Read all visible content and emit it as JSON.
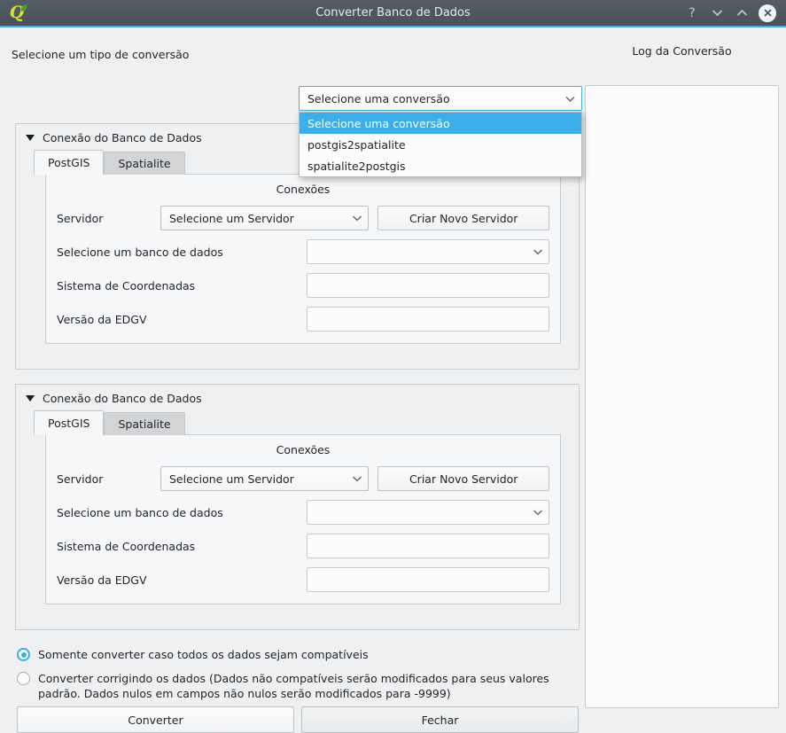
{
  "window": {
    "title": "Converter Banco de Dados",
    "app_icon": "qgis-logo-icon",
    "controls": {
      "help": "?",
      "minimize": "minimize-icon",
      "maximize": "maximize-icon",
      "close": "close-icon"
    },
    "accent_color": "#3daee9",
    "titlebar_color": "#4d555c",
    "background_color": "#eff0f1"
  },
  "conversion": {
    "label": "Selecione um tipo de conversão",
    "combo_value": "Selecione uma conversão",
    "dropdown_open": true,
    "options": [
      "Selecione uma conversão",
      "postgis2spatialite",
      "spatialite2postgis"
    ],
    "selected_index": 0
  },
  "group_source": {
    "title": "Conexão do Banco de Dados",
    "expanded": true,
    "tabs": [
      {
        "label": "PostGIS",
        "active": true
      },
      {
        "label": "Spatialite",
        "active": false
      }
    ],
    "panel_title": "Conexões",
    "fields": {
      "servidor_label": "Servidor",
      "servidor_value": "Selecione um Servidor",
      "criar_servidor_button": "Criar Novo Servidor",
      "banco_label": "Selecione um banco de dados",
      "banco_value": "",
      "sistema_label": "Sistema de Coordenadas",
      "sistema_value": "",
      "edgv_label": "Versão da EDGV",
      "edgv_value": ""
    }
  },
  "group_target": {
    "title": "Conexão do Banco de Dados",
    "expanded": true,
    "tabs": [
      {
        "label": "PostGIS",
        "active": true
      },
      {
        "label": "Spatialite",
        "active": false
      }
    ],
    "panel_title": "Conexões",
    "fields": {
      "servidor_label": "Servidor",
      "servidor_value": "Selecione um Servidor",
      "criar_servidor_button": "Criar Novo Servidor",
      "banco_label": "Selecione um banco de dados",
      "banco_value": "",
      "sistema_label": "Sistema de Coordenadas",
      "sistema_value": "",
      "edgv_label": "Versão da EDGV",
      "edgv_value": ""
    }
  },
  "options": {
    "strict": {
      "label": "Somente converter caso todos os dados sejam compatíveis",
      "checked": true
    },
    "fix": {
      "label": "Converter corrigindo os dados (Dados não compatíveis serão modificados para seus valores padrão. Dados nulos em campos não nulos serão modificados para -9999)",
      "checked": false
    }
  },
  "actions": {
    "convert": "Converter",
    "close": "Fechar"
  },
  "log": {
    "title": "Log da Conversão",
    "content": ""
  }
}
